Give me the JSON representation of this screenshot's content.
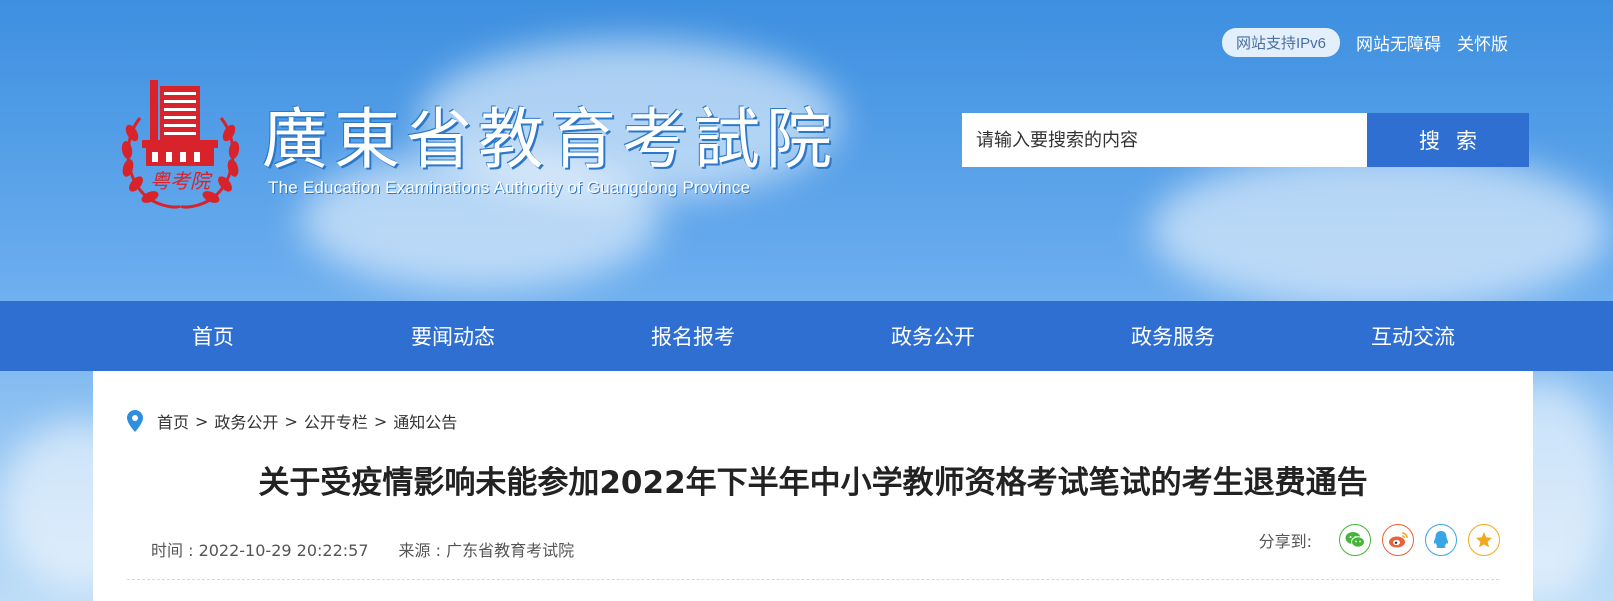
{
  "header": {
    "cn_title": "廣東省教育考試院",
    "en_title": "The Education Examinations Authority of Guangdong Province",
    "logo_text": "粤考院",
    "top_links": {
      "ipv6": "网站支持IPv6",
      "accessibility": "网站无障碍",
      "elderly": "关怀版"
    },
    "search": {
      "placeholder": "请输入要搜索的内容",
      "button": "搜索"
    }
  },
  "nav": {
    "items": [
      "首页",
      "要闻动态",
      "报名报考",
      "政务公开",
      "政务服务",
      "互动交流"
    ]
  },
  "breadcrumb": [
    "首页",
    "政务公开",
    "公开专栏",
    "通知公告"
  ],
  "breadcrumb_sep": ">",
  "article": {
    "title": "关于受疫情影响未能参加2022年下半年中小学教师资格考试笔试的考生退费通告",
    "time": "时间 : 2022-10-29 20:22:57",
    "source": "来源 : 广东省教育考试院"
  },
  "share": {
    "label": "分享到:",
    "icons": [
      "wechat-icon",
      "weibo-icon",
      "qq-icon",
      "favorite-icon"
    ]
  },
  "colors": {
    "nav_bg": "#2f6fd1",
    "brand_red": "#d9232a",
    "wechat": "#46b43c",
    "weibo": "#e8633a",
    "qq": "#3aa5e3",
    "favorite": "#f2a81f"
  }
}
